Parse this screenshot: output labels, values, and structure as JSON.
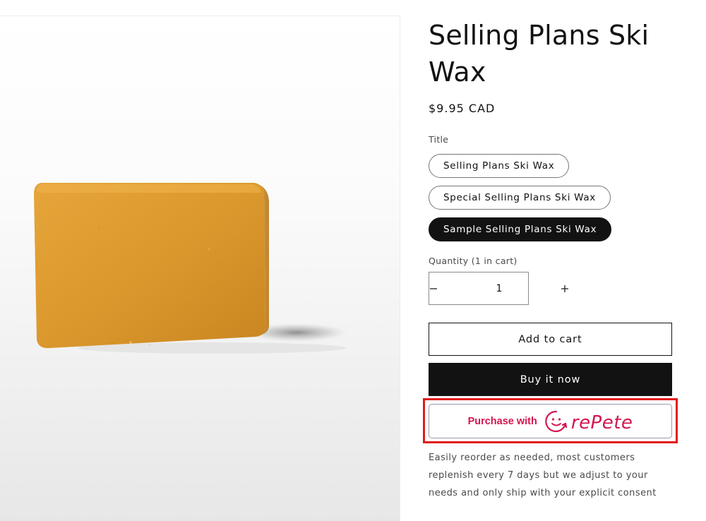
{
  "product": {
    "title": "Selling Plans Ski Wax",
    "price": "$9.95 CAD",
    "image_alt": "Bar of yellow ski wax"
  },
  "variant": {
    "label": "Title",
    "options": [
      "Selling Plans Ski Wax",
      "Special Selling Plans Ski Wax",
      "Sample Selling Plans Ski Wax"
    ],
    "selected_index": 2
  },
  "quantity": {
    "label": "Quantity (1 in cart)",
    "value": "1",
    "decrease_symbol": "−",
    "increase_symbol": "+"
  },
  "actions": {
    "add_to_cart": "Add to cart",
    "buy_now": "Buy it now",
    "repete_prefix": "Purchase with",
    "repete_brand": "rePete",
    "repete_color": "#d4164f",
    "highlight_color": "#e21b1b"
  },
  "description": "Easily reorder as needed, most customers replenish every 7 days but we adjust to your needs and only ship with your explicit consent"
}
